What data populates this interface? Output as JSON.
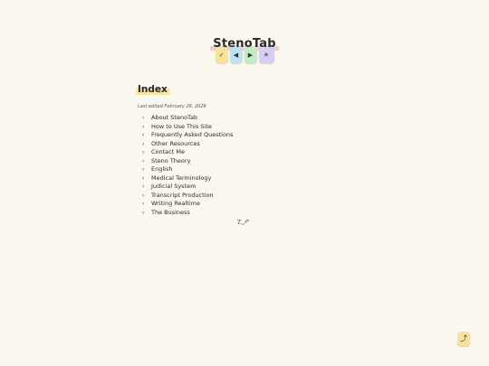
{
  "site": {
    "title": "StenoTab"
  },
  "toolbar": {
    "buttons": [
      {
        "label": "✓",
        "icon": "check-icon",
        "color": "#f7e29a"
      },
      {
        "label": "◀",
        "icon": "previous-icon",
        "color": "#bfe1f0"
      },
      {
        "label": "▶",
        "icon": "next-icon",
        "color": "#c2ecc4"
      },
      {
        "label": "☀",
        "icon": "theme-toggle-icon",
        "color": "#d6cff4"
      }
    ]
  },
  "index": {
    "heading": "Index",
    "last_edited": "Last edited February 28, 2026",
    "chevron": "›",
    "items": [
      "About StenoTab",
      "How to Use This Site",
      "Frequently Asked Questions",
      "Other Resources",
      "Contact Me",
      "Steno Theory",
      "English",
      "Medical Terminology",
      "Judicial System",
      "Transcript Production",
      "Writing Realtime",
      "The Business"
    ]
  },
  "footer": {
    "signature": "T.🖊"
  },
  "scroll_top": {
    "label": "⤴",
    "icon": "scroll-to-top-icon",
    "color": "#f8e39c"
  },
  "colors": {
    "background": "#fbf8f0",
    "title_highlight": "#f6c8dc",
    "heading_highlight": "#f7e4a6"
  }
}
